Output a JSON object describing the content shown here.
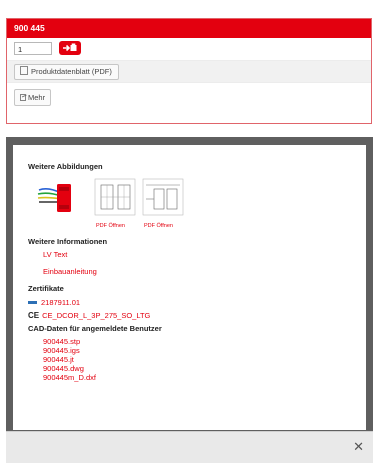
{
  "product": {
    "number": "900 445",
    "quantity": "1",
    "datasheet_label": "Produktdatenblatt (PDF)",
    "more_label": "Mehr"
  },
  "modal": {
    "images_heading": "Weitere Abbildungen",
    "pdf_open_1": "PDF Öffnen",
    "pdf_open_2": "PDF Öffnen",
    "info_heading": "Weitere Informationen",
    "info_links": [
      "LV Text",
      "Einbauanleitung"
    ],
    "cert_heading": "Zertifikate",
    "cert_1": "2187911.01",
    "cert_2": "CE_DCOR_L_3P_275_SO_LTG",
    "cad_heading": "CAD-Daten für angemeldete Benutzer",
    "cad_files": [
      "900445.stp",
      "900445.igs",
      "900445.jt",
      "900445.dwg",
      "900445m_D.dxf"
    ]
  },
  "colors": {
    "accent": "#e3000f",
    "modal_frame": "#5f5f5f"
  },
  "icons": [
    "add-to-cart-icon",
    "pdf-icon",
    "more-icon",
    "certificate-icon",
    "ce-mark-icon",
    "close-icon"
  ]
}
